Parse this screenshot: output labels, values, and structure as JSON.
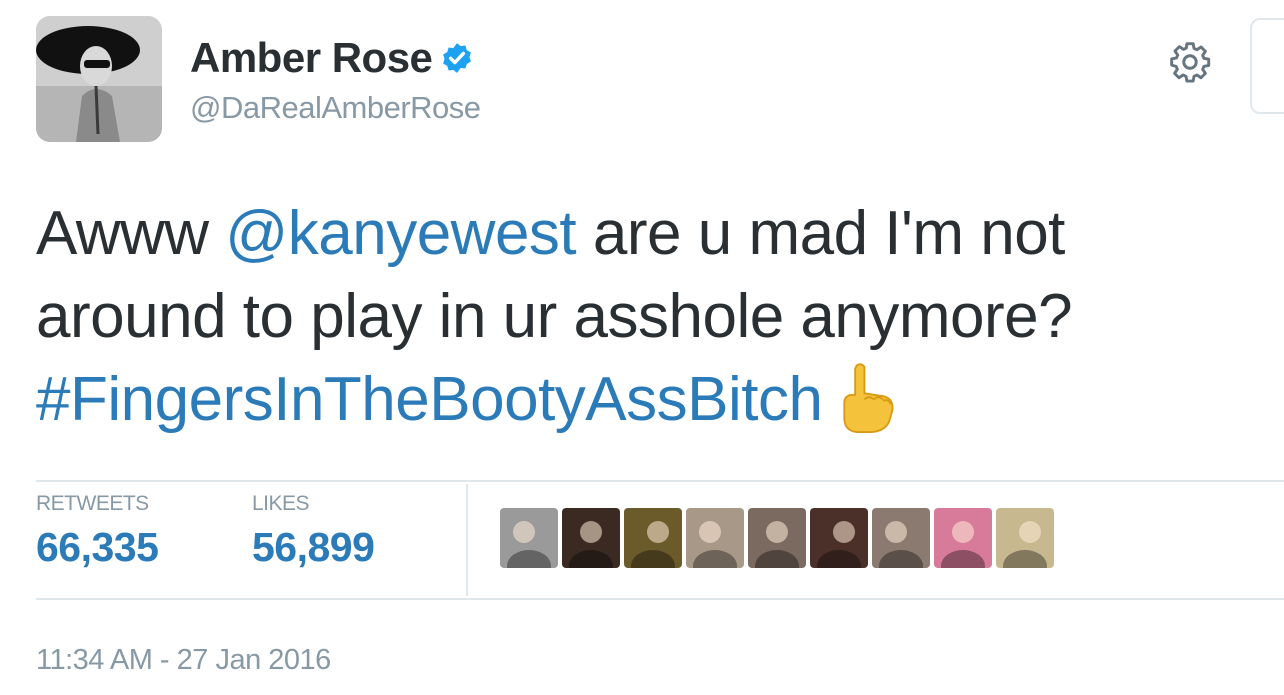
{
  "user": {
    "display_name": "Amber Rose",
    "handle": "@DaRealAmberRose",
    "verified": true
  },
  "tweet": {
    "line1_prefix": "Awww ",
    "mention": "@kanyewest",
    "line1_suffix": " are u mad I'm not",
    "line2": "around to play in ur asshole anymore?",
    "hashtag": "#FingersInTheBootyAssBitch",
    "emoji": "backhand-index-pointing-up-icon"
  },
  "stats": {
    "retweets_label": "RETWEETS",
    "retweets_value": "66,335",
    "likes_label": "LIKES",
    "likes_value": "56,899"
  },
  "likers": [
    {
      "name": "liker-avatar-1",
      "color": "#9a9a9a"
    },
    {
      "name": "liker-avatar-2",
      "color": "#3a2a22"
    },
    {
      "name": "liker-avatar-3",
      "color": "#6b5a2a"
    },
    {
      "name": "liker-avatar-4",
      "color": "#a89888"
    },
    {
      "name": "liker-avatar-5",
      "color": "#7a6a60"
    },
    {
      "name": "liker-avatar-6",
      "color": "#4a3028"
    },
    {
      "name": "liker-avatar-7",
      "color": "#8a7a70"
    },
    {
      "name": "liker-avatar-8",
      "color": "#d87a9a"
    },
    {
      "name": "liker-avatar-9",
      "color": "#c8b890"
    }
  ],
  "timestamp": "11:34 AM - 27 Jan 2016",
  "colors": {
    "link": "#2b7bb9",
    "text": "#292f33",
    "muted": "#8899a6",
    "verified": "#1da1f2",
    "divider": "#e1e8ed"
  }
}
